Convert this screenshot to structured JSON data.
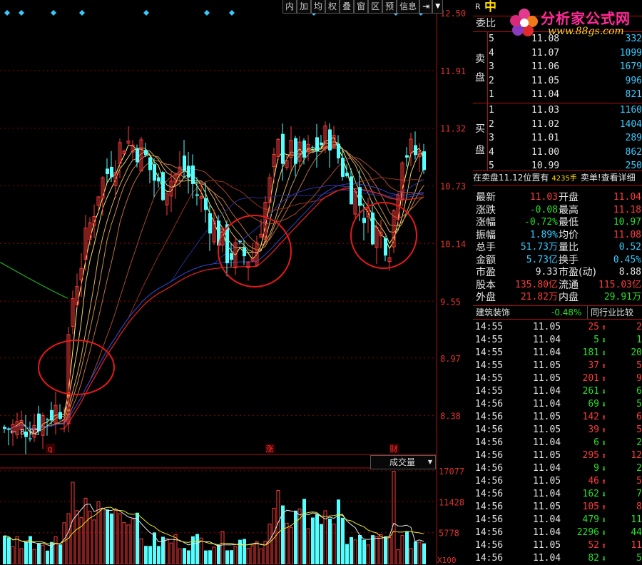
{
  "toolbar": {
    "items": [
      "内",
      "加",
      "均",
      "权",
      "叠",
      "窗",
      "区",
      "预",
      "信息"
    ],
    "arrow_icon": "arrow-right-bar-icon",
    "dropdown_icon": "triangle-down-icon"
  },
  "price_axis": {
    "labels": [
      "12.50",
      "11.91",
      "11.32",
      "10.73",
      "10.14",
      "9.55",
      "8.97",
      "8.38"
    ]
  },
  "low_marker": "8.02",
  "event_markers": [
    "q",
    "涨",
    "财"
  ],
  "volume_panel": {
    "indicator": "成交量",
    "axis_labels": [
      "17077",
      "11428",
      "5778"
    ],
    "unit": "X100"
  },
  "watermark": {
    "line1": "分析家公式网",
    "line2": "www.88gs.com"
  },
  "header": {
    "r": "R",
    "name_char": "中"
  },
  "weibi_label": "委比",
  "sell_label": "卖盘",
  "buy_label": "买盘",
  "asks": [
    {
      "level": "5",
      "price": "11.08",
      "vol": "332"
    },
    {
      "level": "4",
      "price": "11.07",
      "vol": "1099"
    },
    {
      "level": "3",
      "price": "11.06",
      "vol": "1679"
    },
    {
      "level": "2",
      "price": "11.05",
      "vol": "996"
    },
    {
      "level": "1",
      "price": "11.04",
      "vol": "821"
    }
  ],
  "bids": [
    {
      "level": "1",
      "price": "11.03",
      "vol": "1160"
    },
    {
      "level": "2",
      "price": "11.02",
      "vol": "1404"
    },
    {
      "level": "3",
      "price": "11.01",
      "vol": "289"
    },
    {
      "level": "4",
      "price": "11.00",
      "vol": "862"
    },
    {
      "level": "5",
      "price": "10.99",
      "vol": "250"
    }
  ],
  "notice": {
    "text1": "在卖盘11.12位置有",
    "vol": "4235手",
    "text2": "卖单!",
    "link": "查看详细"
  },
  "stats": [
    {
      "l1": "最新",
      "v1": "11.03",
      "c1": "red",
      "l2": "开盘",
      "v2": "11.04",
      "c2": "red"
    },
    {
      "l1": "涨跌",
      "v1": "-0.08",
      "c1": "green",
      "l2": "最高",
      "v2": "11.18",
      "c2": "red"
    },
    {
      "l1": "涨幅",
      "v1": "-0.72%",
      "c1": "green",
      "l2": "最低",
      "v2": "10.97",
      "c2": "green"
    },
    {
      "l1": "振幅",
      "v1": "1.89%",
      "c1": "cyan",
      "l2": "均价",
      "v2": "11.08",
      "c2": "red"
    },
    {
      "l1": "总手",
      "v1": "51.73万",
      "c1": "cyan",
      "l2": "量比",
      "v2": "0.52",
      "c2": "cyan"
    },
    {
      "l1": "金额",
      "v1": "5.73亿",
      "c1": "cyan",
      "l2": "换手",
      "v2": "0.45%",
      "c2": "cyan"
    },
    {
      "l1": "市盈",
      "v1": "9.33",
      "c1": "white",
      "l2": "市盈(动)",
      "v2": "8.88",
      "c2": "white"
    },
    {
      "l1": "股本",
      "v1": "135.80亿",
      "c1": "red",
      "l2": "流通",
      "v2": "115.03亿",
      "c2": "red"
    },
    {
      "l1": "外盘",
      "v1": "21.82万",
      "c1": "red",
      "l2": "内盘",
      "v2": "29.91万",
      "c2": "green"
    }
  ],
  "industry": {
    "name": "建筑装饰",
    "change": "-0.48%",
    "compare_button": "同行业比较"
  },
  "ticks": [
    {
      "time": "14:55",
      "price": "11.05",
      "vol": "25",
      "dir": "up",
      "extra": "2"
    },
    {
      "time": "14:55",
      "price": "11.04",
      "vol": "5",
      "dir": "down",
      "extra": "1"
    },
    {
      "time": "14:55",
      "price": "11.04",
      "vol": "181",
      "dir": "down",
      "extra": "20"
    },
    {
      "time": "14:55",
      "price": "11.05",
      "vol": "37",
      "dir": "up",
      "extra": "5"
    },
    {
      "time": "14:55",
      "price": "11.05",
      "vol": "201",
      "dir": "up",
      "extra": "9"
    },
    {
      "time": "14:55",
      "price": "11.04",
      "vol": "261",
      "dir": "down",
      "extra": "6"
    },
    {
      "time": "14:56",
      "price": "11.04",
      "vol": "69",
      "dir": "down",
      "extra": "5"
    },
    {
      "time": "14:56",
      "price": "11.05",
      "vol": "142",
      "dir": "up",
      "extra": "6"
    },
    {
      "time": "14:56",
      "price": "11.05",
      "vol": "39",
      "dir": "up",
      "extra": "5"
    },
    {
      "time": "14:56",
      "price": "11.04",
      "vol": "6",
      "dir": "down",
      "extra": "2"
    },
    {
      "time": "14:56",
      "price": "11.05",
      "vol": "295",
      "dir": "up",
      "extra": "12"
    },
    {
      "time": "14:56",
      "price": "11.04",
      "vol": "9",
      "dir": "down",
      "extra": "2"
    },
    {
      "time": "14:56",
      "price": "11.05",
      "vol": "46",
      "dir": "up",
      "extra": "5"
    },
    {
      "time": "14:56",
      "price": "11.04",
      "vol": "162",
      "dir": "down",
      "extra": "7"
    },
    {
      "time": "14:56",
      "price": "11.05",
      "vol": "105",
      "dir": "up",
      "extra": "8"
    },
    {
      "time": "14:56",
      "price": "11.04",
      "vol": "479",
      "dir": "down",
      "extra": "11"
    },
    {
      "time": "14:56",
      "price": "11.04",
      "vol": "2296",
      "dir": "down",
      "extra": "44"
    },
    {
      "time": "14:56",
      "price": "11.05",
      "vol": "52",
      "dir": "up",
      "extra": "11"
    },
    {
      "time": "14:56",
      "price": "11.04",
      "vol": "82",
      "dir": "down",
      "extra": "5"
    }
  ],
  "colors": {
    "up": "#ff3b3b",
    "down": "#54ffff",
    "ma_red": "#d02020",
    "ma_green": "#1fa01f",
    "grid": "#8b0000",
    "circle": "#e81818"
  },
  "chart_data": {
    "type": "candlestick",
    "y_range": [
      8.02,
      12.5
    ],
    "y_ticks": [
      12.5,
      11.91,
      11.32,
      10.73,
      10.14,
      9.55,
      8.97,
      8.38
    ],
    "low_marked": 8.02,
    "volume_ticks": [
      17077,
      11428,
      5778
    ],
    "volume_unit": "X100"
  }
}
